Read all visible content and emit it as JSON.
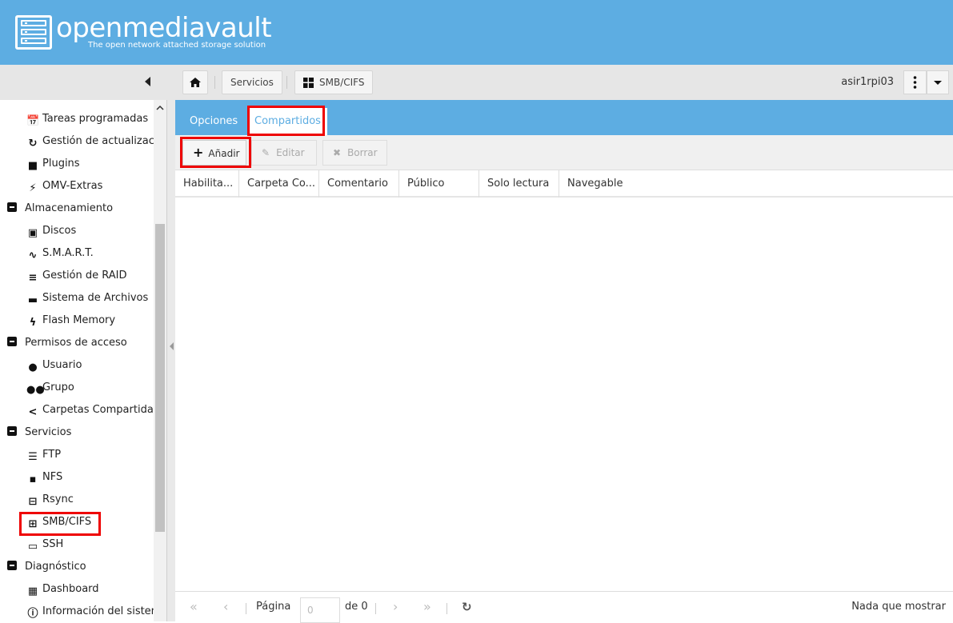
{
  "brand": {
    "name": "openmediavault",
    "tagline": "The open network attached storage solution"
  },
  "breadcrumbs": {
    "home": "",
    "section": "Servicios",
    "page": "SMB/CIFS"
  },
  "host": "asir1rpi03",
  "sidebar": {
    "items": [
      {
        "label": "Tareas programadas",
        "icon": "calendar-clock-icon"
      },
      {
        "label": "Gestión de actualizacio",
        "icon": "refresh-icon"
      },
      {
        "label": "Plugins",
        "icon": "puzzle-icon"
      },
      {
        "label": "OMV-Extras",
        "icon": "plug-icon"
      },
      {
        "label": "Almacenamiento",
        "icon": "collapse-icon",
        "group": true
      },
      {
        "label": "Discos",
        "icon": "disk-icon"
      },
      {
        "label": "S.M.A.R.T.",
        "icon": "pulse-icon"
      },
      {
        "label": "Gestión de RAID",
        "icon": "database-icon"
      },
      {
        "label": "Sistema de Archivos",
        "icon": "folders-icon"
      },
      {
        "label": "Flash Memory",
        "icon": "flash-icon"
      },
      {
        "label": "Permisos de acceso",
        "icon": "collapse-icon",
        "group": true
      },
      {
        "label": "Usuario",
        "icon": "user-icon"
      },
      {
        "label": "Grupo",
        "icon": "group-icon"
      },
      {
        "label": "Carpetas Compartidas",
        "icon": "share-icon"
      },
      {
        "label": "Servicios",
        "icon": "collapse-icon",
        "group": true
      },
      {
        "label": "FTP",
        "icon": "server-icon"
      },
      {
        "label": "NFS",
        "icon": "nfs-icon"
      },
      {
        "label": "Rsync",
        "icon": "network-icon"
      },
      {
        "label": "SMB/CIFS",
        "icon": "windows-icon"
      },
      {
        "label": "SSH",
        "icon": "terminal-icon"
      },
      {
        "label": "Diagnóstico",
        "icon": "collapse-icon",
        "group": true
      },
      {
        "label": "Dashboard",
        "icon": "dashboard-icon"
      },
      {
        "label": "Información del sistem",
        "icon": "info-icon"
      }
    ]
  },
  "tabs": [
    {
      "label": "Opciones"
    },
    {
      "label": "Compartidos"
    }
  ],
  "actions": {
    "add": "Añadir",
    "edit": "Editar",
    "delete": "Borrar"
  },
  "columns": [
    "Habilita...",
    "Carpeta Co...",
    "Comentario",
    "Público",
    "Solo lectura",
    "Navegable"
  ],
  "pager": {
    "page_label": "Página",
    "page_value": "0",
    "of_label": "de 0",
    "empty": "Nada que mostrar"
  },
  "colors": {
    "header": "#5dade2",
    "highlight": "#e00000"
  }
}
